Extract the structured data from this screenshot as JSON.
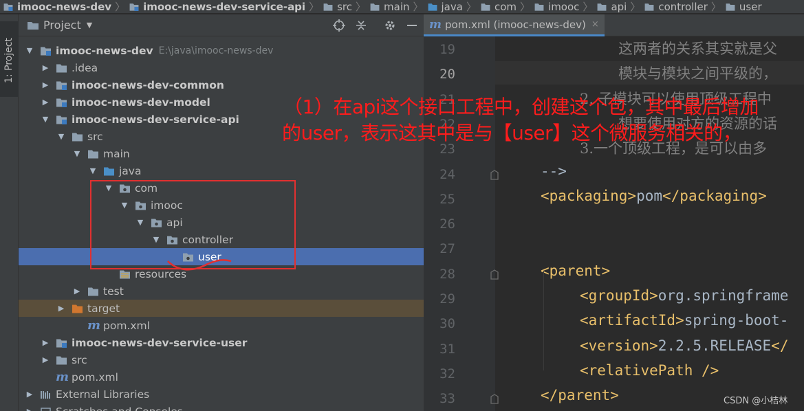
{
  "breadcrumb": [
    {
      "label": "imooc-news-dev",
      "bold": true
    },
    {
      "label": "imooc-news-dev-service-api",
      "bold": true
    },
    {
      "label": "src"
    },
    {
      "label": "main"
    },
    {
      "label": "java"
    },
    {
      "label": "com"
    },
    {
      "label": "imooc"
    },
    {
      "label": "api"
    },
    {
      "label": "controller"
    },
    {
      "label": "user"
    }
  ],
  "toolstrip": {
    "project_tab": "1: Project"
  },
  "project_panel": {
    "title": "Project",
    "tree": [
      {
        "label": "imooc-news-dev",
        "path": "E:\\java\\imooc-news-dev",
        "depth": 0,
        "arrow": "down",
        "icon": "module-folder-icon",
        "bold": true
      },
      {
        "label": ".idea",
        "depth": 1,
        "arrow": "right",
        "icon": "folder-icon"
      },
      {
        "label": "imooc-news-dev-common",
        "depth": 1,
        "arrow": "right",
        "icon": "module-folder-icon",
        "bold": true
      },
      {
        "label": "imooc-news-dev-model",
        "depth": 1,
        "arrow": "right",
        "icon": "module-folder-icon",
        "bold": true
      },
      {
        "label": "imooc-news-dev-service-api",
        "depth": 1,
        "arrow": "down",
        "icon": "module-folder-icon",
        "bold": true
      },
      {
        "label": "src",
        "depth": 2,
        "arrow": "down",
        "icon": "folder-icon"
      },
      {
        "label": "main",
        "depth": 3,
        "arrow": "down",
        "icon": "folder-icon"
      },
      {
        "label": "java",
        "depth": 4,
        "arrow": "down",
        "icon": "source-folder-icon"
      },
      {
        "label": "com",
        "depth": 5,
        "arrow": "down",
        "icon": "package-icon"
      },
      {
        "label": "imooc",
        "depth": 6,
        "arrow": "down",
        "icon": "package-icon"
      },
      {
        "label": "api",
        "depth": 7,
        "arrow": "down",
        "icon": "package-icon"
      },
      {
        "label": "controller",
        "depth": 8,
        "arrow": "down",
        "icon": "package-icon"
      },
      {
        "label": "user",
        "depth": 9,
        "arrow": "none",
        "icon": "package-icon",
        "selected": true
      },
      {
        "label": "resources",
        "depth": 5,
        "arrow": "none",
        "icon": "resources-folder-icon"
      },
      {
        "label": "test",
        "depth": 3,
        "arrow": "right",
        "icon": "folder-icon"
      },
      {
        "label": "target",
        "depth": 2,
        "arrow": "right",
        "icon": "excluded-folder-icon",
        "highlight": true
      },
      {
        "label": "pom.xml",
        "depth": 3,
        "arrow": "none",
        "icon": "maven-icon"
      },
      {
        "label": "imooc-news-dev-service-user",
        "depth": 1,
        "arrow": "right",
        "icon": "module-folder-icon",
        "bold": true
      },
      {
        "label": "src",
        "depth": 1,
        "arrow": "right",
        "icon": "folder-icon"
      },
      {
        "label": "pom.xml",
        "depth": 1,
        "arrow": "none",
        "icon": "maven-icon"
      },
      {
        "label": "External Libraries",
        "depth": 0,
        "arrow": "right",
        "icon": "libraries-icon"
      },
      {
        "label": "Scratches and Consoles",
        "depth": 0,
        "arrow": "right",
        "icon": "scratches-icon"
      }
    ]
  },
  "editor": {
    "tab_label": "pom.xml (imooc-news-dev)",
    "tab_close": "×",
    "current_line": "20",
    "lines": [
      {
        "num": "19",
        "parts": [
          {
            "t": "c",
            "s": "这两者的关系其实就是父"
          }
        ],
        "indent": 1
      },
      {
        "num": "20",
        "parts": [
          {
            "t": "c",
            "s": "模块与模块之间平级的，"
          }
        ],
        "indent": 1
      },
      {
        "num": "21",
        "parts": [
          {
            "t": "c",
            "s": "2. 子模块可以使用顶级工程中"
          }
        ],
        "indent": 2
      },
      {
        "num": "22",
        "parts": [
          {
            "t": "c",
            "s": "想要使用对方的资源的话"
          }
        ],
        "indent": 1
      },
      {
        "num": "23",
        "parts": [
          {
            "t": "c",
            "s": "3.一个顶级工程，是可以由多"
          }
        ],
        "indent": 3
      },
      {
        "num": "24",
        "parts": [
          {
            "t": "c",
            "s": "-->"
          }
        ],
        "indent": 0
      },
      {
        "num": "25",
        "parts": [
          {
            "t": "g",
            "s": "<packaging>"
          },
          {
            "t": "x",
            "s": "pom"
          },
          {
            "t": "g",
            "s": "</packaging>"
          }
        ],
        "indent": 0
      },
      {
        "num": "26",
        "parts": [],
        "indent": 0
      },
      {
        "num": "27",
        "parts": [],
        "indent": 0
      },
      {
        "num": "28",
        "parts": [
          {
            "t": "g",
            "s": "<parent>"
          }
        ],
        "indent": 0
      },
      {
        "num": "29",
        "parts": [
          {
            "t": "g",
            "s": "<groupId>"
          },
          {
            "t": "x",
            "s": "org.springframe"
          }
        ],
        "indent": 4
      },
      {
        "num": "30",
        "parts": [
          {
            "t": "g",
            "s": "<artifactId>"
          },
          {
            "t": "x",
            "s": "spring-boot-"
          }
        ],
        "indent": 4
      },
      {
        "num": "31",
        "parts": [
          {
            "t": "g",
            "s": "<version>"
          },
          {
            "t": "x",
            "s": "2.2.5.RELEASE"
          },
          {
            "t": "g",
            "s": "</"
          }
        ],
        "indent": 4
      },
      {
        "num": "32",
        "parts": [
          {
            "t": "g",
            "s": "<relativePath />"
          }
        ],
        "indent": 4
      },
      {
        "num": "33",
        "parts": [
          {
            "t": "g",
            "s": "</parent>"
          }
        ],
        "indent": 0
      }
    ]
  },
  "annotation": {
    "line1": "（1）在api这个接口工程中，创建这个包，其中最后增加",
    "line2": "的user，表示这其中是与【user】这个微服务相关的，",
    "color": "#ff1c1c"
  },
  "watermark": "CSDN @小桔林",
  "colors": {
    "selection": "#4b6eaf",
    "panel": "#3c3f41",
    "editor": "#2b2b2b",
    "tag": "#e8bf6a"
  }
}
